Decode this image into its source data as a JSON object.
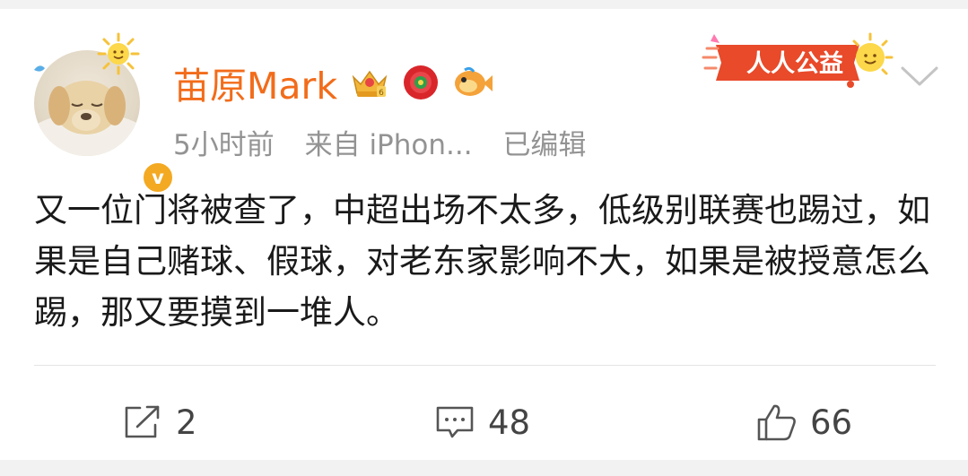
{
  "post": {
    "author": "苗原Mark",
    "time": "5小时前",
    "source": "来自 iPhon...",
    "edited": "已编辑",
    "verified_mark": "v",
    "charity_badge": "人人公益",
    "content": "又一位门将被查了，中超出场不太多，低级别联赛也踢过，如果是自己赌球、假球，对老东家影响不大，如果是被授意怎么踢，那又要摸到一堆人。",
    "icons": {
      "badges": [
        "crown-badge-icon",
        "red-flower-badge-icon",
        "fish-badge-icon"
      ],
      "menu": "chevron-down-icon"
    }
  },
  "actions": {
    "share_count": "2",
    "comment_count": "48",
    "like_count": "66"
  },
  "colors": {
    "username": "#f26c1a",
    "meta": "#939393",
    "vbadge": "#f4a922",
    "charity": "#e84a2a"
  }
}
